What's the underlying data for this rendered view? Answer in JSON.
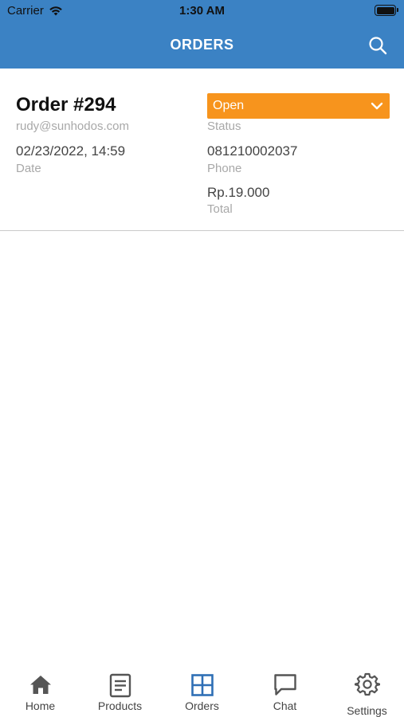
{
  "status_bar": {
    "carrier": "Carrier",
    "time": "1:30 AM"
  },
  "navbar": {
    "title": "ORDERS",
    "search_icon": "search-icon"
  },
  "order": {
    "title": "Order #294",
    "email": "rudy@sunhodos.com",
    "date": "02/23/2022, 14:59",
    "date_label": "Date",
    "status": "Open",
    "status_label": "Status",
    "phone": "081210002037",
    "phone_label": "Phone",
    "total": "Rp.19.000",
    "total_label": "Total"
  },
  "tabs": [
    {
      "label": "Home",
      "icon": "home-icon"
    },
    {
      "label": "Products",
      "icon": "list-icon"
    },
    {
      "label": "Orders",
      "icon": "grid-icon",
      "active": true
    },
    {
      "label": "Chat",
      "icon": "chat-icon"
    },
    {
      "label": "Settings",
      "icon": "gear-icon"
    }
  ],
  "colors": {
    "header": "#3b82c4",
    "status_open": "#f7941d",
    "active_tab": "#2f6fb5",
    "inactive_tab": "#555555"
  }
}
